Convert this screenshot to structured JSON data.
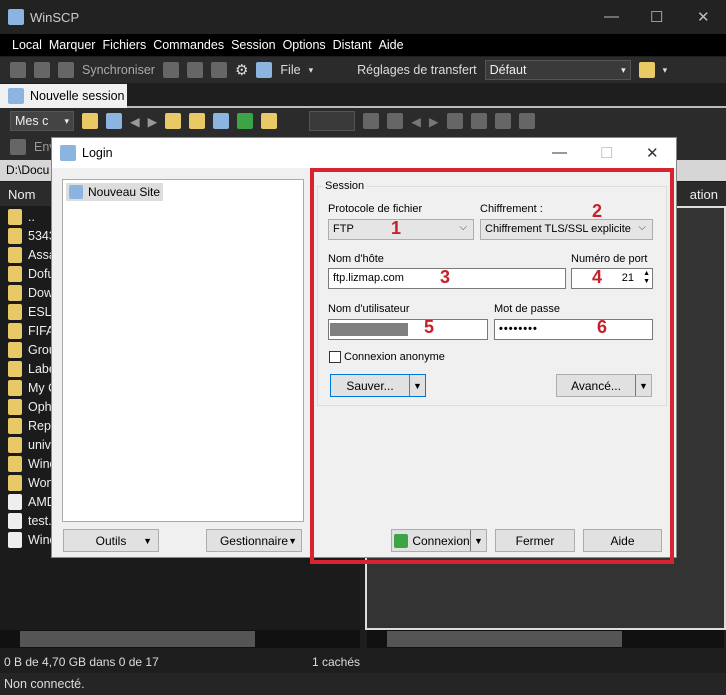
{
  "window": {
    "title": "WinSCP",
    "minimize": "—",
    "maximize": "☐",
    "close": "✕"
  },
  "menu": [
    "Local",
    "Marquer",
    "Fichiers",
    "Commandes",
    "Session",
    "Options",
    "Distant",
    "Aide"
  ],
  "toolbar": {
    "sync": "Synchroniser",
    "file": "File",
    "transfer_label": "Réglages de transfert",
    "transfer_value": "Défaut"
  },
  "tab": {
    "label": "Nouvelle session"
  },
  "local_toolbar": {
    "drive": "Mes c",
    "send": "Env"
  },
  "path": "D:\\Docu",
  "columns": {
    "local_name": "Nom",
    "remote_partial": "ation"
  },
  "files": [
    "..",
    "5343",
    "Assas",
    "Dofu",
    "Dow",
    "ESL N",
    "FIFA",
    "Grou",
    "Labe",
    "My G",
    "Ophe",
    "Repla",
    "unive",
    "Wind",
    "Won",
    "AMD",
    "test.r",
    "Wind"
  ],
  "status": {
    "selection": "0 B de 4,70 GB dans 0 de 17",
    "hidden": "1 cachés",
    "connection": "Non connecté."
  },
  "dialog": {
    "title": "Login",
    "tree": [
      "Nouveau Site"
    ],
    "buttons": {
      "tools": "Outils",
      "manager": "Gestionnaire",
      "save": "Sauver...",
      "advanced": "Avancé...",
      "connect": "Connexion",
      "close": "Fermer",
      "help": "Aide"
    },
    "session": {
      "group": "Session",
      "protocol_label": "Protocole de fichier",
      "protocol": "FTP",
      "encryption_label": "Chiffrement :",
      "encryption": "Chiffrement TLS/SSL explicite",
      "host_label": "Nom d'hôte",
      "host": "ftp.lizmap.com",
      "port_label": "Numéro de port",
      "port": "21",
      "user_label": "Nom d'utilisateur",
      "user": "",
      "password_label": "Mot de passe",
      "password": "••••••••",
      "anonymous_label": "Connexion anonyme",
      "anonymous": false
    },
    "annotations": [
      "1",
      "2",
      "3",
      "4",
      "5",
      "6"
    ],
    "highlight_color": "#d9232e"
  }
}
